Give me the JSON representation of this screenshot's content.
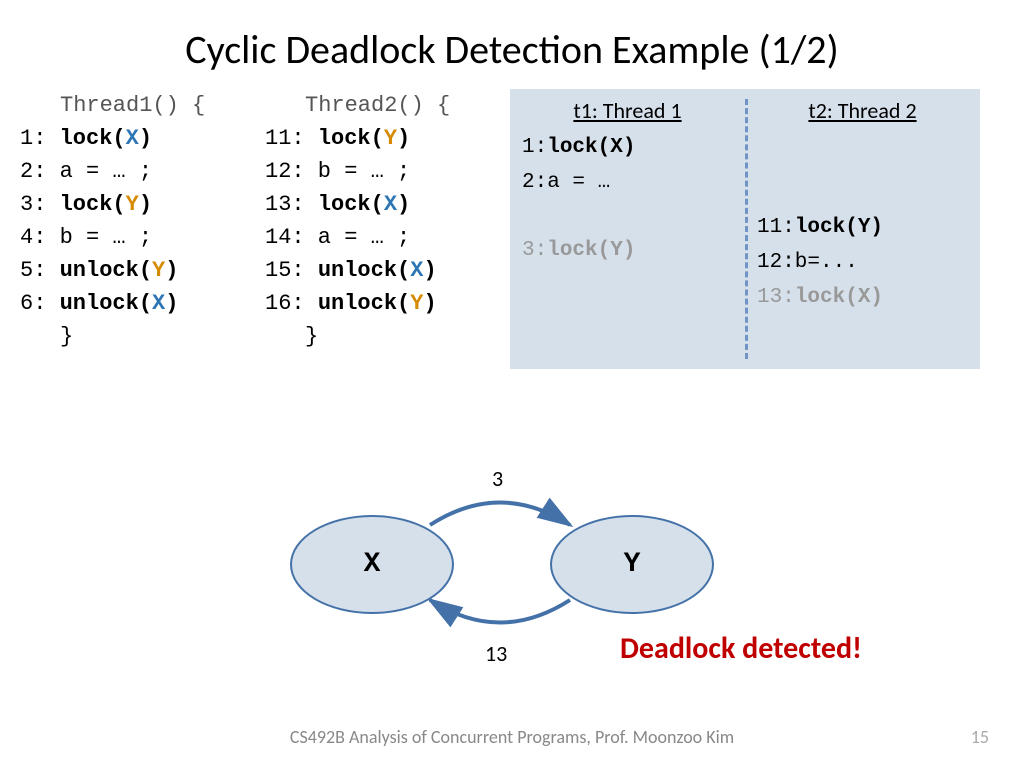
{
  "title": "Cyclic Deadlock Detection Example (1/2)",
  "thread1": {
    "header": "Thread1() {",
    "l1a": "1: ",
    "l1b": "lock(",
    "l1c": "X",
    "l1d": ")",
    "l2": "2: a = … ;",
    "l3a": "3: ",
    "l3b": "lock(",
    "l3c": "Y",
    "l3d": ")",
    "l4": "4: b = … ;",
    "l5a": "5: ",
    "l5b": "unlock(",
    "l5c": "Y",
    "l5d": ")",
    "l6a": "6: ",
    "l6b": "unlock(",
    "l6c": "X",
    "l6d": ")",
    "close": "}"
  },
  "thread2": {
    "header": "Thread2() {",
    "l1a": "11: ",
    "l1b": "lock(",
    "l1c": "Y",
    "l1d": ")",
    "l2": "12: b = … ;",
    "l3a": "13: ",
    "l3b": "lock(",
    "l3c": "X",
    "l3d": ")",
    "l4": "14: a = … ;",
    "l5a": "15: ",
    "l5b": "unlock(",
    "l5c": "X",
    "l5d": ")",
    "l6a": "16: ",
    "l6b": "unlock(",
    "l6c": "Y",
    "l6d": ")",
    "close": "}"
  },
  "trace": {
    "h1": "t1: Thread 1",
    "h2": "t2: Thread 2",
    "t1_1a": "1:",
    "t1_1b": "lock(X)",
    "t1_2": "2:a = …",
    "t1_3a": "3:",
    "t1_3b": "lock(Y)",
    "t2_1a": "11:",
    "t2_1b": "lock(Y)",
    "t2_2": "12:b=...",
    "t2_3a": "13:",
    "t2_3b": "lock(X)"
  },
  "diagram": {
    "x": "X",
    "y": "Y",
    "top_label": "3",
    "bot_label": "13"
  },
  "alert": "Deadlock detected!",
  "footer": "CS492B Analysis of Concurrent Programs, Prof. Moonzoo Kim",
  "page": "15"
}
